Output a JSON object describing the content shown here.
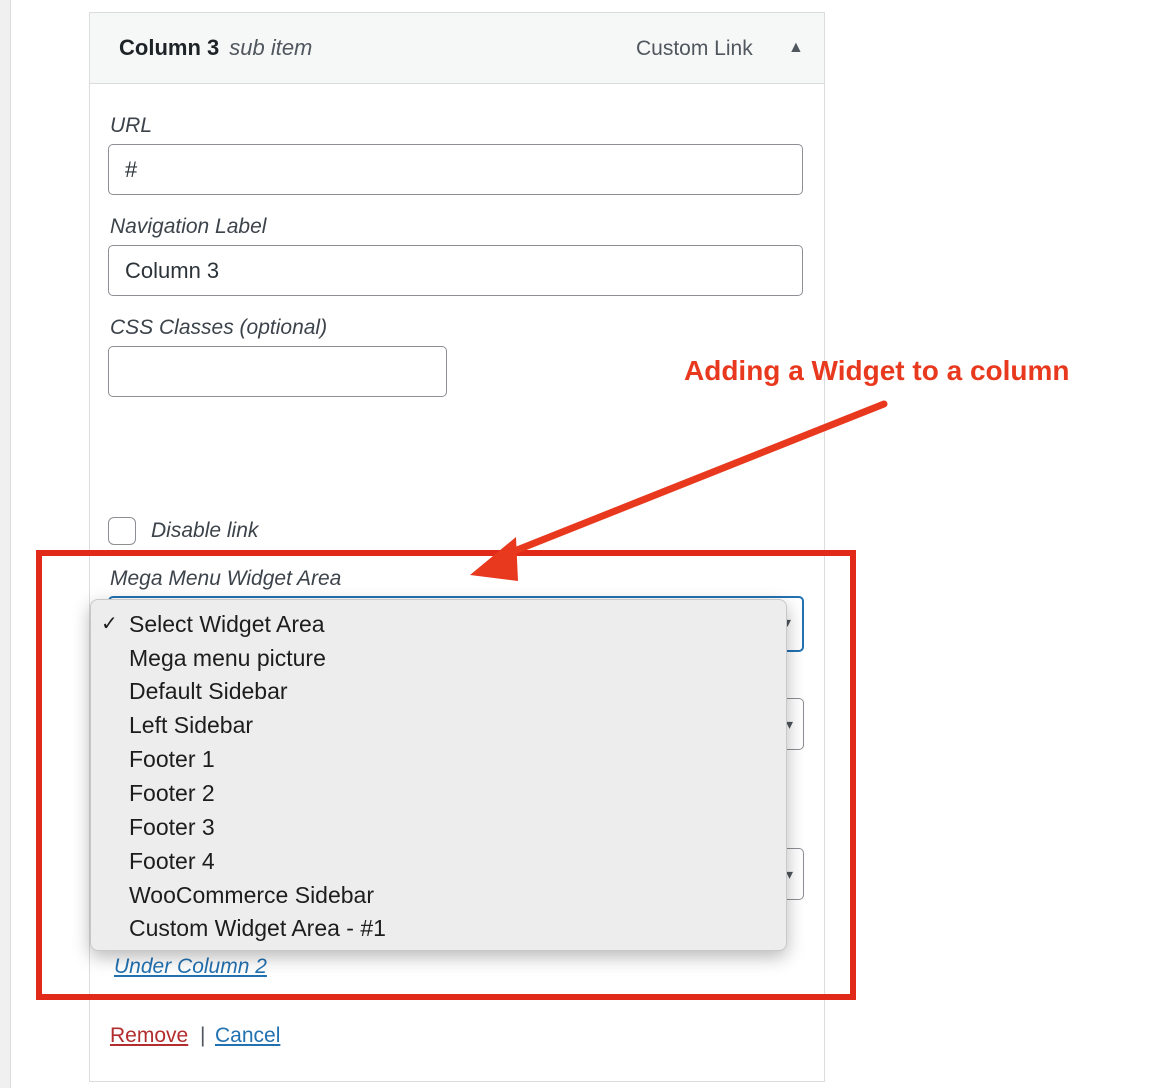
{
  "menu_item": {
    "title": "Column 3",
    "subtitle": "sub item",
    "type_label": "Custom Link"
  },
  "fields": {
    "url_label": "URL",
    "url_value": "#",
    "nav_label_label": "Navigation Label",
    "nav_label_value": "Column 3",
    "css_label": "CSS Classes (optional)",
    "css_value": "",
    "disable_link_label": "Disable link",
    "widget_area_label": "Mega Menu Widget Area"
  },
  "dropdown": {
    "checkmark": "✓",
    "options": [
      "Select Widget Area",
      "Mega menu picture",
      "Default Sidebar",
      "Left Sidebar",
      "Footer 1",
      "Footer 2",
      "Footer 3",
      "Footer 4",
      "WooCommerce Sidebar",
      "Custom Widget Area - #1"
    ],
    "selected_index": 0
  },
  "links": {
    "under_column": "Under Column 2",
    "remove": "Remove",
    "separator": "|",
    "cancel": "Cancel"
  },
  "annotation": {
    "text": "Adding a Widget to a column"
  },
  "colors": {
    "annotation": "#e8391f",
    "focus_border": "#2271b1",
    "remove_link": "#b32d2e",
    "cancel_link": "#2271b1"
  },
  "icons": {
    "toggle": "triangle-up-icon",
    "select_caret": "chevron-down-icon",
    "annotation_arrow": "arrow-icon"
  }
}
